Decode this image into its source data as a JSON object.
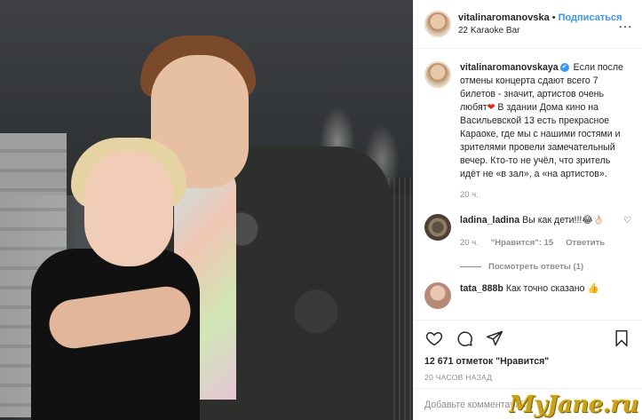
{
  "post": {
    "username": "vitalinaromanovska",
    "follow_label": "Подписаться",
    "separator": "•",
    "location": "22 Karaoke Bar",
    "more_label": "…"
  },
  "caption": {
    "username": "vitalinaromanovskaya",
    "verified": "✔",
    "text_part1": " Если после отмены концерта сдают всего 7 билетов - значит, артистов очень любят",
    "heart": "❤",
    "text_part2": " В здании Дома кино на Васильевской 13 есть прекрасное Караоке, где мы с нашими гостями и зрителями провели замечательный вечер. Кто-то не учёл, что зритель идёт не «в зал», а «на артистов».",
    "age": "20 ч."
  },
  "comments": [
    {
      "username": "ladina_ladina",
      "text": " Вы как дети!!!😂👌🏻",
      "age": "20 ч.",
      "likes": "\"Нравится\": 15",
      "reply_label": "Ответить",
      "like_icon": "♡"
    }
  ],
  "view_replies_label": "Посмотреть ответы (1)",
  "partial_comment": {
    "username": "tata_888b",
    "text": " Как точно сказано 👍"
  },
  "actions": {
    "likes_text": "12 671 отметок \"Нравится\"",
    "time_text": "20 ЧАСОВ НАЗАД",
    "add_comment_placeholder": "Добавьте комментарий..."
  },
  "watermark": "MyJane.ru",
  "colors": {
    "accent": "#3897f0",
    "heart": "#d9261c",
    "muted": "#8e8e8e",
    "watermark": "#c9a21c"
  },
  "icons": [
    "heart-icon",
    "comment-icon",
    "share-icon",
    "bookmark-icon",
    "verified-icon",
    "more-icon"
  ]
}
